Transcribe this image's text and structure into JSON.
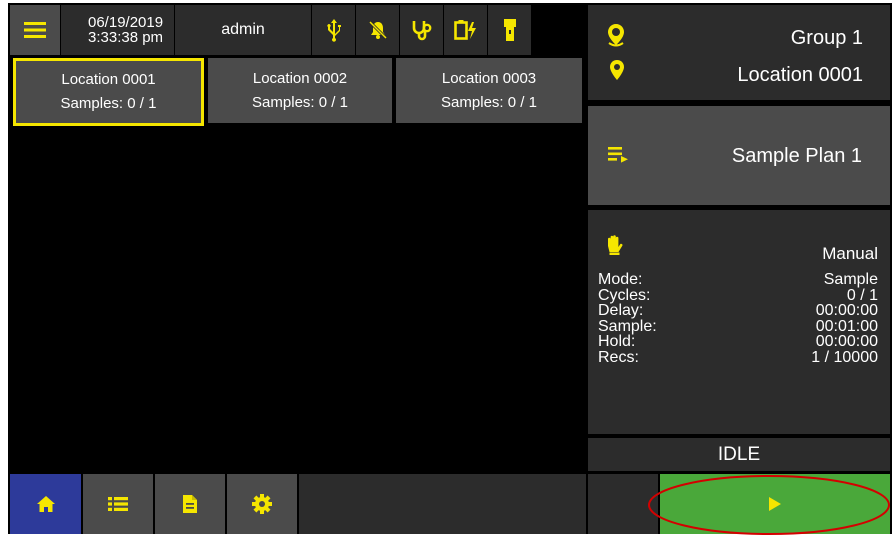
{
  "header": {
    "date": "06/19/2019",
    "time": "3:33:38 pm",
    "user": "admin",
    "icons": [
      "menu-icon",
      "usb-icon",
      "alarm-off-icon",
      "stethoscope-icon",
      "battery-charging-icon",
      "flashlight-icon"
    ]
  },
  "locations": [
    {
      "name": "Location 0001",
      "samples": "Samples: 0 / 1",
      "selected": true
    },
    {
      "name": "Location 0002",
      "samples": "Samples: 0 / 1",
      "selected": false
    },
    {
      "name": "Location 0003",
      "samples": "Samples: 0 / 1",
      "selected": false
    }
  ],
  "right_panel": {
    "group": "Group 1",
    "location": "Location 0001",
    "sample_plan": "Sample Plan 1",
    "mode_title": "Manual",
    "stats": [
      {
        "label": "Mode:",
        "value": "Sample"
      },
      {
        "label": "Cycles:",
        "value": "0 / 1"
      },
      {
        "label": "Delay:",
        "value": "00:00:00"
      },
      {
        "label": "Sample:",
        "value": "00:01:00"
      },
      {
        "label": "Hold:",
        "value": "00:00:00"
      },
      {
        "label": "Recs:",
        "value": "1 / 10000"
      }
    ],
    "status": "IDLE"
  },
  "bottom_nav": [
    "home-icon",
    "list-icon",
    "document-icon",
    "gear-icon"
  ],
  "colors": {
    "accent": "#f5e600",
    "active_tab": "#2d3a9a",
    "play": "#4aa83a",
    "highlight_oval": "#d40000"
  }
}
